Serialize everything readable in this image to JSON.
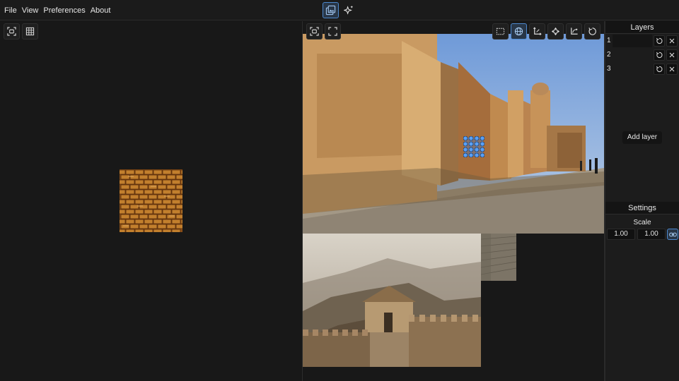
{
  "menu": {
    "items": [
      "File",
      "View",
      "Preferences",
      "About"
    ]
  },
  "modes": [
    {
      "name": "image-composite-icon",
      "active": true
    },
    {
      "name": "sparkles-icon",
      "active": false
    }
  ],
  "left_toolbar": [
    "fit-view-icon",
    "grid-icon"
  ],
  "center_toolbar": {
    "left": [
      "fit-view-icon",
      "fullscreen-icon"
    ],
    "right": [
      {
        "name": "rectangle-select-icon",
        "active": false
      },
      {
        "name": "globe-icon",
        "active": true
      },
      {
        "name": "axis-corner-icon",
        "active": false
      },
      {
        "name": "rotate-arrows-icon",
        "active": false
      },
      {
        "name": "curve-corner-icon",
        "active": false
      },
      {
        "name": "reset-icon",
        "active": false
      }
    ]
  },
  "layers": {
    "title": "Layers",
    "items": [
      {
        "label": "1"
      },
      {
        "label": "2"
      },
      {
        "label": "3"
      }
    ],
    "add_label": "Add layer"
  },
  "settings": {
    "title": "Settings",
    "scale_label": "Scale",
    "scale_x": "1.00",
    "scale_y": "1.00"
  },
  "colors": {
    "accent": "#4d89cf",
    "background": "#181818",
    "text": "#e8e8e8"
  }
}
